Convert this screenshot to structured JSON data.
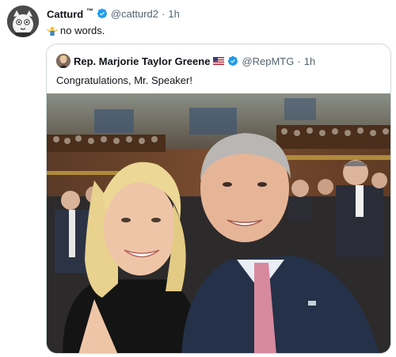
{
  "tweet": {
    "display_name": "Catturd",
    "name_mark": "™",
    "handle": "@catturd2",
    "separator": "·",
    "time": "1h",
    "text": "no words.",
    "text_emoji": "person-shrugging-icon"
  },
  "quoted_tweet": {
    "display_name": "Rep. Marjorie Taylor Greene",
    "flag": "us-flag-icon",
    "handle": "@RepMTG",
    "separator": "·",
    "time": "1h",
    "text": "Congratulations, Mr. Speaker!",
    "photo": "selfie-photo"
  },
  "colors": {
    "verified": "#1d9bf0",
    "muted_text": "#536471",
    "border": "#cfd9de",
    "chamber_wood": "#6b3f28"
  }
}
